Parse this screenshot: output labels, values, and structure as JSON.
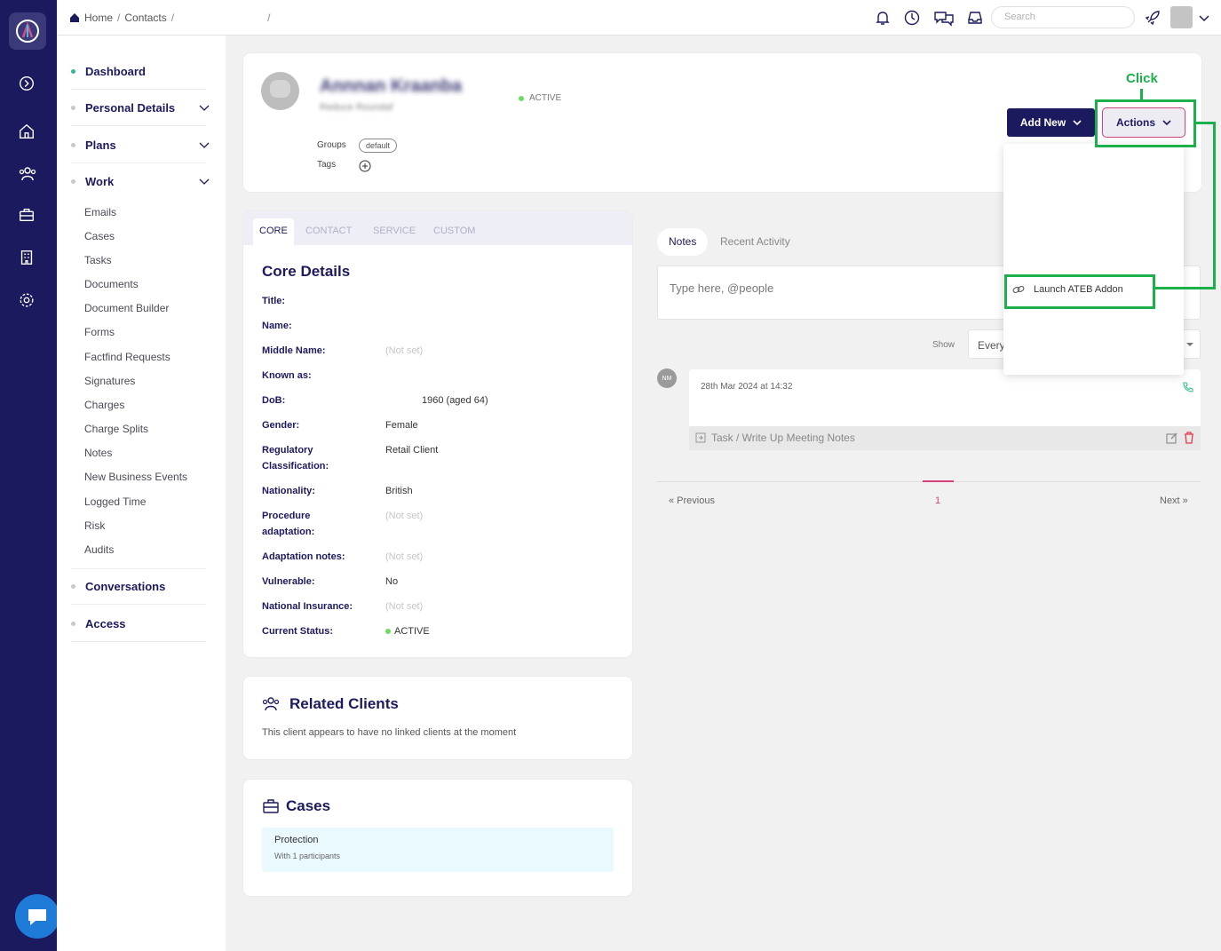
{
  "breadcrumb": {
    "home": "Home",
    "contacts": "Contacts",
    "sep": "/"
  },
  "search": {
    "placeholder": "Search"
  },
  "sidebar": {
    "sections": [
      {
        "label": "Dashboard"
      },
      {
        "label": "Personal Details"
      },
      {
        "label": "Plans"
      },
      {
        "label": "Work"
      },
      {
        "label": "Conversations"
      },
      {
        "label": "Access"
      }
    ],
    "work_items": [
      "Emails",
      "Cases",
      "Tasks",
      "Documents",
      "Document Builder",
      "Forms",
      "Factfind Requests",
      "Signatures",
      "Charges",
      "Charge Splits",
      "Notes",
      "New Business Events",
      "Logged Time",
      "Risk",
      "Audits"
    ]
  },
  "header": {
    "name": "Annnan Kraanba",
    "subtitle": "Reduce Roundaf",
    "status": "ACTIVE",
    "groups_label": "Groups",
    "group_pill": "default",
    "tags_label": "Tags",
    "add_new": "Add New",
    "actions": "Actions"
  },
  "dropdown": {
    "launch": "Launch ATEB Addon"
  },
  "annotation": {
    "click": "Click",
    "color": "#1bb04a"
  },
  "core": {
    "tabs": [
      "CORE",
      "CONTACT",
      "SERVICE",
      "CUSTOM"
    ],
    "title": "Core Details",
    "fields": [
      {
        "label": "Title:",
        "value": ""
      },
      {
        "label": "Name:",
        "value": ""
      },
      {
        "label": "Middle Name:",
        "value": "(Not set)"
      },
      {
        "label": "Known as:",
        "value": ""
      },
      {
        "label": "DoB:",
        "value": "1960 (aged 64)"
      },
      {
        "label": "Gender:",
        "value": "Female"
      },
      {
        "label": "Regulatory Classification:",
        "value": "Retail Client"
      },
      {
        "label": "Nationality:",
        "value": "British"
      },
      {
        "label": "Procedure adaptation:",
        "value": "(Not set)"
      },
      {
        "label": "Adaptation notes:",
        "value": "(Not set)"
      },
      {
        "label": "Vulnerable:",
        "value": "No"
      },
      {
        "label": "National Insurance:",
        "value": "(Not set)"
      },
      {
        "label": "Current Status:",
        "value": "ACTIVE"
      }
    ]
  },
  "related": {
    "title": "Related Clients",
    "text": "This client appears to have no linked clients at the moment"
  },
  "cases": {
    "title": "Cases",
    "item_title": "Protection",
    "item_sub": "With 1 participants"
  },
  "notes": {
    "tab_notes": "Notes",
    "tab_activity": "Recent Activity",
    "placeholder": "Type here, @people",
    "show_label": "Show",
    "show_value": "Every",
    "initials": "NM",
    "date": "28th Mar 2024 at 14:32",
    "footer": "Task / Write Up Meeting Notes",
    "prev": "« Previous",
    "page": "1",
    "next": "Next »"
  },
  "colors": {
    "navy": "#1c1a5e",
    "accent": "#d63f77",
    "active_green": "#6ddc5f"
  }
}
